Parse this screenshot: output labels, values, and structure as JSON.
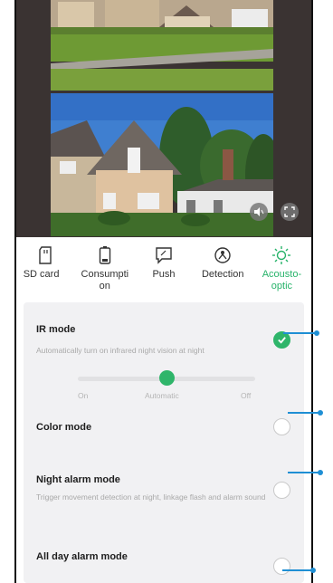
{
  "preview": {
    "speaker_icon": "speaker-icon",
    "fullscreen_icon": "fullscreen-icon"
  },
  "tabs": [
    {
      "label": "SD card",
      "icon": "sd-card-icon",
      "active": false
    },
    {
      "label": "Consumpti\non",
      "icon": "battery-icon",
      "active": false
    },
    {
      "label": "Push",
      "icon": "push-message-icon",
      "active": false
    },
    {
      "label": "Detection",
      "icon": "detection-icon",
      "active": false
    },
    {
      "label": "Acousto-\noptic",
      "icon": "sun-icon",
      "active": true
    }
  ],
  "ir_mode": {
    "title": "IR mode",
    "description": "Automatically turn on infrared night vision at night",
    "checked": true,
    "slider": {
      "options": [
        "On",
        "Automatic",
        "Off"
      ],
      "selected": "Automatic"
    }
  },
  "color_mode": {
    "title": "Color mode",
    "checked": false
  },
  "night_alarm_mode": {
    "title": "Night alarm mode",
    "description": "Trigger movement detection at night, linkage flash and alarm sound",
    "checked": false
  },
  "all_day_alarm_mode": {
    "title": "All day alarm mode",
    "checked": false
  },
  "colors": {
    "accent": "#2fb56a",
    "pointer": "#1f8fd4"
  }
}
